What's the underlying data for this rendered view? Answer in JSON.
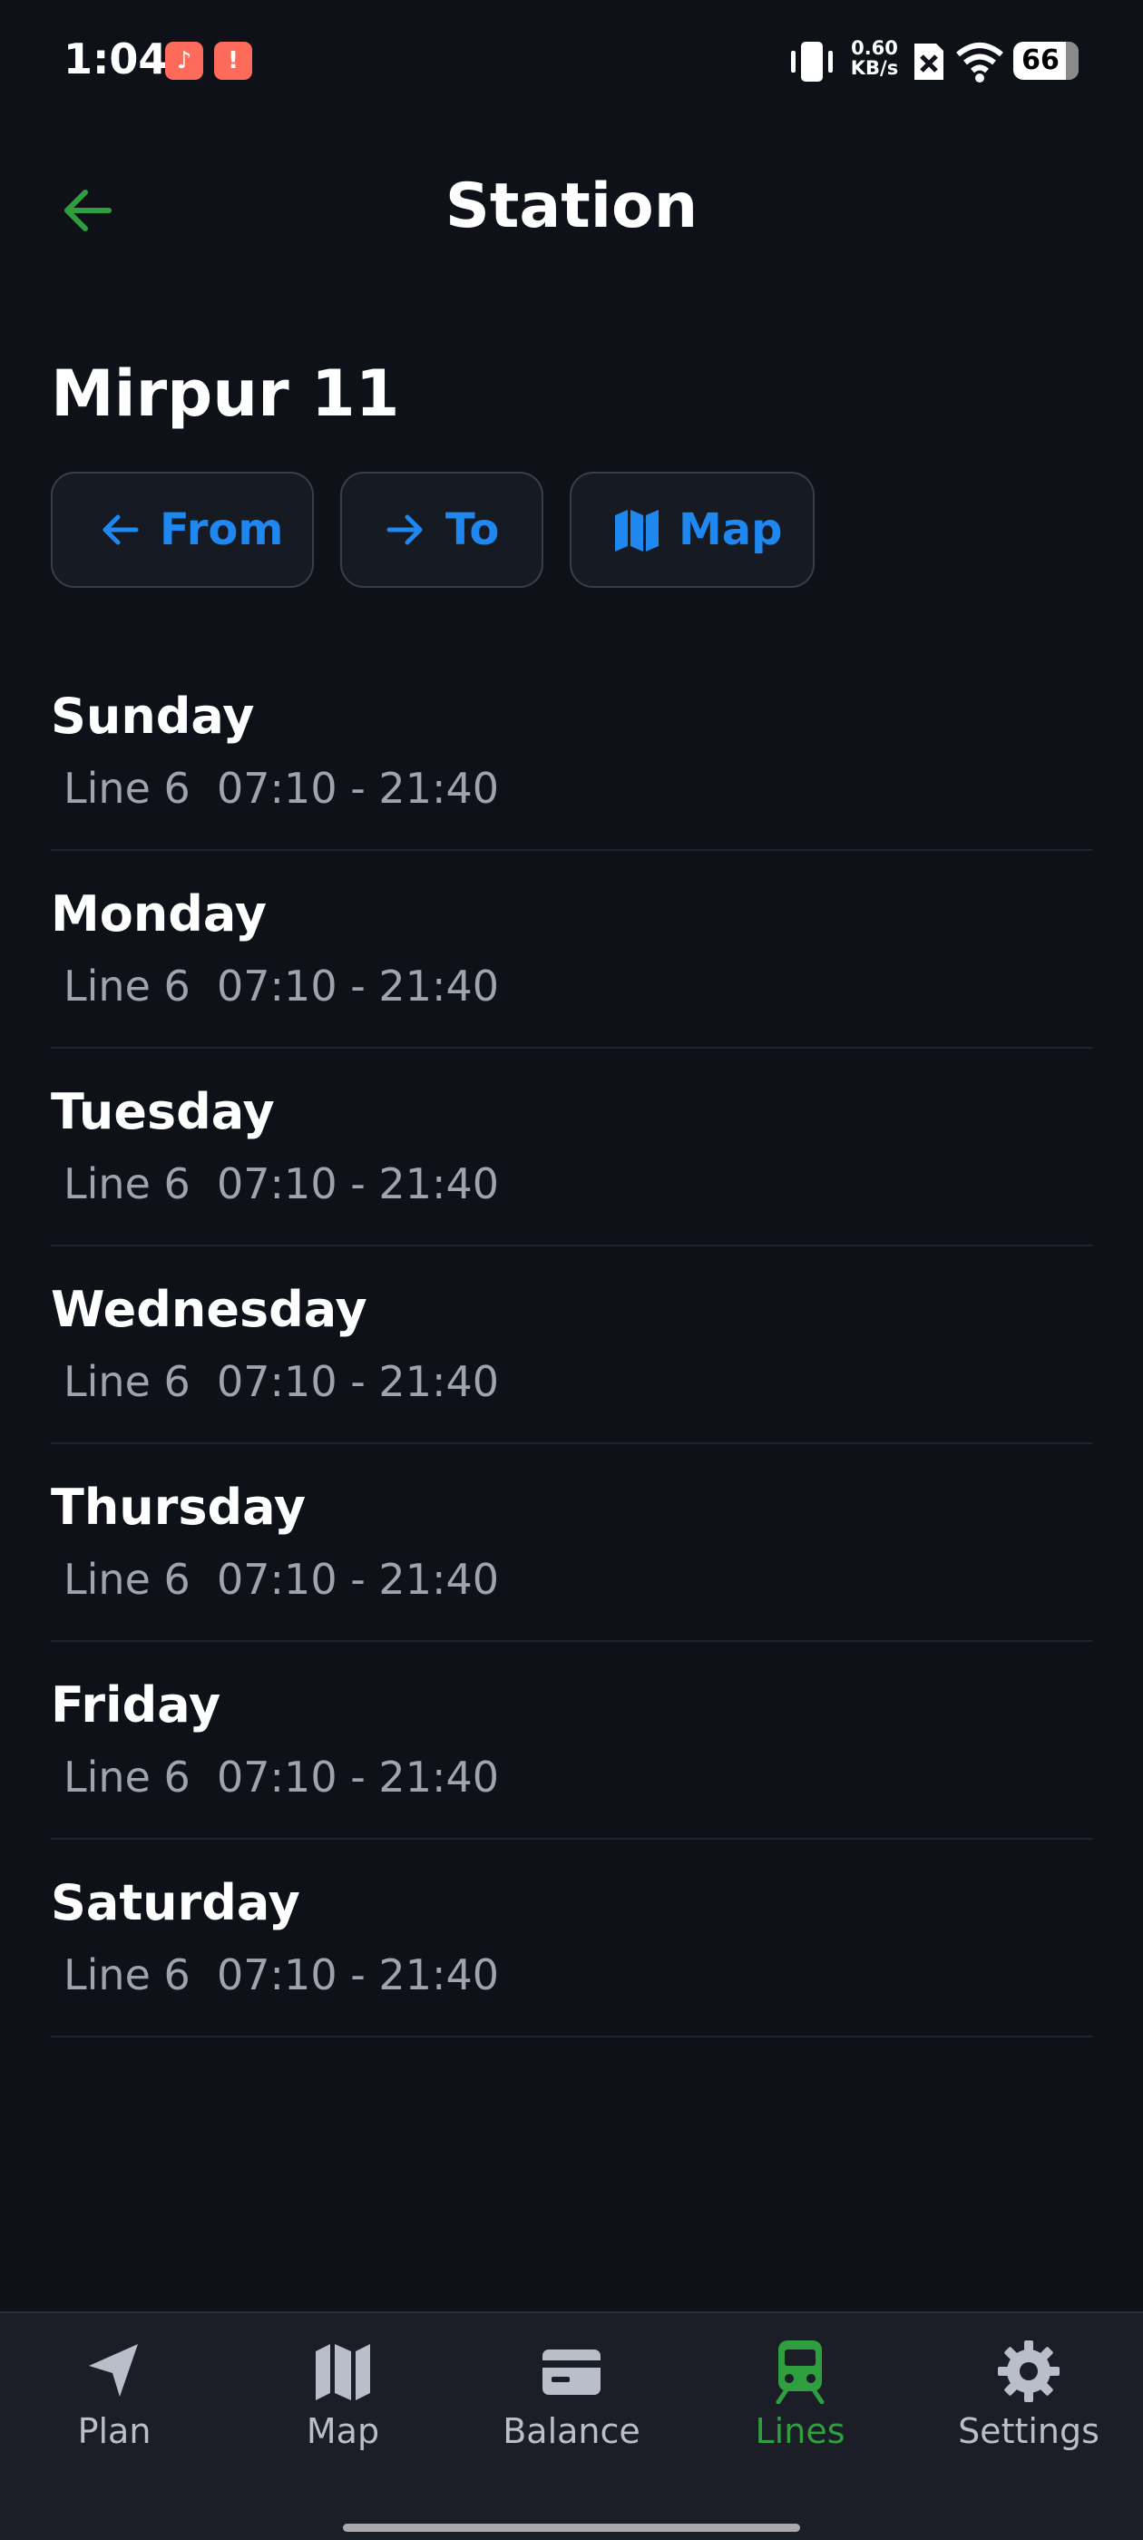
{
  "status_bar": {
    "time": "1:04",
    "net_speed_value": "0.60",
    "net_speed_unit": "KB/s",
    "battery": "66"
  },
  "header": {
    "title": "Station"
  },
  "station": {
    "name": "Mirpur 11"
  },
  "actions": {
    "from_label": "From",
    "to_label": "To",
    "map_label": "Map"
  },
  "schedule": [
    {
      "day": "Sunday",
      "line": "Line 6",
      "hours": "07:10 - 21:40"
    },
    {
      "day": "Monday",
      "line": "Line 6",
      "hours": "07:10 - 21:40"
    },
    {
      "day": "Tuesday",
      "line": "Line 6",
      "hours": "07:10 - 21:40"
    },
    {
      "day": "Wednesday",
      "line": "Line 6",
      "hours": "07:10 - 21:40"
    },
    {
      "day": "Thursday",
      "line": "Line 6",
      "hours": "07:10 - 21:40"
    },
    {
      "day": "Friday",
      "line": "Line 6",
      "hours": "07:10 - 21:40"
    },
    {
      "day": "Saturday",
      "line": "Line 6",
      "hours": "07:10 - 21:40"
    }
  ],
  "bottom_nav": [
    {
      "label": "Plan",
      "icon": "navigation-arrow-icon"
    },
    {
      "label": "Map",
      "icon": "map-icon"
    },
    {
      "label": "Balance",
      "icon": "card-icon"
    },
    {
      "label": "Lines",
      "icon": "train-icon",
      "active": true
    },
    {
      "label": "Settings",
      "icon": "gear-icon"
    }
  ],
  "colors": {
    "background": "#0e1118",
    "accent_blue": "#1e88f0",
    "accent_green": "#2e9e3f",
    "muted_text": "#9ea3ad"
  }
}
